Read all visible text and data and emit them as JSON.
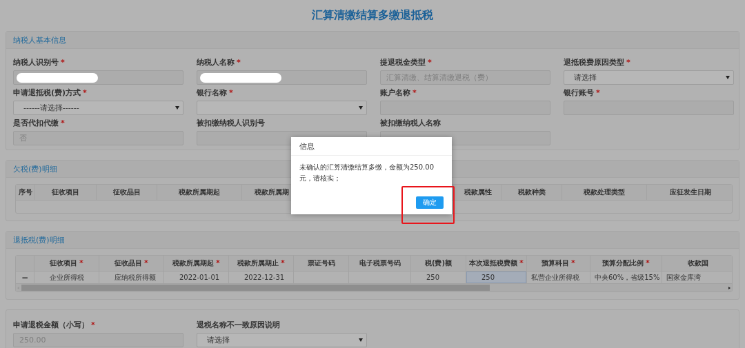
{
  "page_title": "汇算清缴结算多缴退抵税",
  "sections": [
    {
      "kind": "form",
      "title": "纳税人基本信息",
      "fields": [
        {
          "label": "纳税人识别号",
          "required_mark": "*",
          "kind": "text",
          "redacted": true
        },
        {
          "label": "纳税人名称",
          "required_mark": "*",
          "kind": "text",
          "redacted": true
        },
        {
          "label": "提退税金类型",
          "required_mark": "*",
          "kind": "text",
          "value": "汇算清缴、结算清缴退税（费）",
          "redacted": false,
          "disabled": true
        },
        {
          "label": "退抵税费原因类型",
          "required_mark": "*",
          "kind": "select",
          "value": "请选择",
          "redacted": false,
          "disabled": false
        },
        {
          "label": "申请退抵税(费)方式",
          "required_mark": "*",
          "kind": "select",
          "value": "------请选择------",
          "redacted": false,
          "disabled": false
        },
        {
          "label": "银行名称",
          "required_mark": "*",
          "kind": "select",
          "redacted": false
        },
        {
          "label": "账户名称",
          "required_mark": "*",
          "kind": "text",
          "redacted": false
        },
        {
          "label": "银行账号",
          "required_mark": "*",
          "kind": "text",
          "redacted": false
        },
        {
          "label": "是否代扣代缴",
          "required_mark": "*",
          "kind": "text",
          "value": "否",
          "redacted": false,
          "disabled": true
        },
        {
          "label": "被扣缴纳税人识别号",
          "kind": "text",
          "redacted": false
        },
        {
          "label": "被扣缴纳税人名称",
          "kind": "text",
          "redacted": false
        }
      ]
    },
    {
      "kind": "table",
      "title": "欠税(费)明细",
      "columns": [
        {
          "label": "序号"
        },
        {
          "label": "征收项目"
        },
        {
          "label": "征收品目"
        },
        {
          "label": "税款所属期起"
        },
        {
          "label": "税款所属期"
        },
        {
          "label": "税款属性"
        },
        {
          "label": "税款种类"
        },
        {
          "label": "税款处理类型"
        },
        {
          "label": "应征发生日期"
        }
      ]
    },
    {
      "kind": "table",
      "title": "退抵税(费)明细",
      "columns": [
        {
          "label": "征收项目",
          "required_mark": "*"
        },
        {
          "label": "征收品目",
          "required_mark": "*"
        },
        {
          "label": "税款所属期起",
          "required_mark": "*"
        },
        {
          "label": "税款所属期止",
          "required_mark": "*"
        },
        {
          "label": "票证号码"
        },
        {
          "label": "电子税票号码"
        },
        {
          "label": "税(费)额"
        },
        {
          "label": "本次退抵税费额",
          "required_mark": "*"
        },
        {
          "label": "预算科目",
          "required_mark": "*"
        },
        {
          "label": "预算分配比例",
          "required_mark": "*"
        },
        {
          "label": "收款国"
        }
      ],
      "rows": [
        {
          "action": "−",
          "cells": [
            {
              "text": "企业所得税",
              "editable": false
            },
            {
              "text": "应纳税所得额",
              "editable": false
            },
            {
              "text": "2022-01-01",
              "editable": false
            },
            {
              "text": "2022-12-31",
              "editable": false
            },
            {
              "editable": false
            },
            {
              "editable": false
            },
            {
              "text": "250",
              "editable": false
            },
            {
              "text": "250",
              "editable": true
            },
            {
              "text": "私营企业所得税",
              "editable": false
            },
            {
              "text": "中央60%，省级15%",
              "editable": false
            },
            {
              "text": "国家金库湾",
              "editable": false
            }
          ]
        }
      ]
    },
    {
      "kind": "form",
      "fields": [
        {
          "label": "申请退税金额（小写）",
          "required_mark": "*",
          "kind": "text",
          "value": "250.00",
          "redacted": false,
          "disabled": true
        },
        {
          "label": "退税名称不一致原因说明",
          "kind": "select",
          "value": "请选择",
          "redacted": false,
          "disabled": false
        }
      ]
    }
  ],
  "dialog": {
    "title": "信息",
    "message": "未确认的汇算清缴结算多缴，金额为250.00元，请核实；",
    "buttons": [
      {
        "label": "确定",
        "highlighted": true
      }
    ]
  }
}
